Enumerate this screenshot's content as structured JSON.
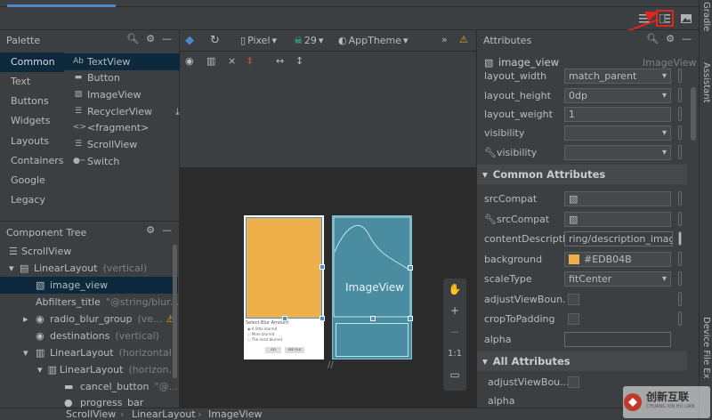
{
  "window": {
    "right_strip": {
      "gradle": "Gradle",
      "assistant": "Assistant",
      "device_explorer": "Device File Ex"
    }
  },
  "palette": {
    "title": "Palette",
    "categories": [
      "Common",
      "Text",
      "Buttons",
      "Widgets",
      "Layouts",
      "Containers",
      "Google",
      "Legacy"
    ],
    "items": [
      {
        "icon": "Ab",
        "label": "TextView"
      },
      {
        "icon": "btn",
        "label": "Button"
      },
      {
        "icon": "img",
        "label": "ImageView"
      },
      {
        "icon": "list",
        "label": "RecyclerView"
      },
      {
        "icon": "<>",
        "label": "<fragment>"
      },
      {
        "icon": "scroll",
        "label": "ScrollView"
      },
      {
        "icon": "switch",
        "label": "Switch"
      }
    ]
  },
  "component_tree": {
    "title": "Component Tree",
    "rows": [
      {
        "label": "ScrollView",
        "extra": ""
      },
      {
        "label": "LinearLayout",
        "extra": "(vertical)"
      },
      {
        "label": "image_view",
        "extra": ""
      },
      {
        "label": "filters_title",
        "extra": "\"@string/blur..."
      },
      {
        "label": "radio_blur_group",
        "extra": "(ve..."
      },
      {
        "label": "destinations",
        "extra": "(vertical)"
      },
      {
        "label": "LinearLayout",
        "extra": "(horizontal)"
      },
      {
        "label": "LinearLayout",
        "extra": "(horizon..."
      },
      {
        "label": "cancel_button",
        "extra": "\"@..."
      },
      {
        "label": "progress_bar",
        "extra": ""
      }
    ]
  },
  "design_toolbar": {
    "device": "Pixel",
    "api": "29",
    "theme": "AppTheme"
  },
  "canvas": {
    "blueprint_label": "ImageView",
    "preview_caption": "Select Blur Amount",
    "options": [
      "A little blurred",
      "More blurred",
      "The most blurred"
    ],
    "buttons": [
      "GO",
      "SEE FILE"
    ],
    "zoom_reset": "1:1"
  },
  "attributes": {
    "title": "Attributes",
    "component_name": "image_view",
    "component_type": "ImageView",
    "layout_rows": [
      {
        "label": "layout_width",
        "value": "match_parent"
      },
      {
        "label": "layout_height",
        "value": "0dp"
      },
      {
        "label": "layout_weight",
        "value": "1"
      },
      {
        "label": "visibility",
        "value": ""
      },
      {
        "label": "visibility",
        "value": ""
      }
    ],
    "common_title": "Common Attributes",
    "common_rows": [
      {
        "label": "srcCompat",
        "value": ""
      },
      {
        "label": "srcCompat",
        "value": ""
      },
      {
        "label": "contentDescripti...",
        "value": "ring/description_image"
      },
      {
        "label": "background",
        "value": "#EDB04B"
      },
      {
        "label": "scaleType",
        "value": "fitCenter"
      },
      {
        "label": "adjustViewBoun...",
        "value": ""
      },
      {
        "label": "cropToPadding",
        "value": ""
      },
      {
        "label": "alpha",
        "value": ""
      }
    ],
    "all_title": "All Attributes",
    "all_rows": [
      {
        "label": "adjustViewBou...",
        "value": ""
      },
      {
        "label": "alpha",
        "value": ""
      }
    ]
  },
  "breadcrumb": [
    "ScrollView",
    "LinearLayout",
    "ImageView"
  ],
  "watermark": {
    "cn": "创新互联",
    "en": "CHUANG XIN HU LIAN"
  },
  "colors": {
    "accent": "#4a88c7",
    "selection": "#0d293e",
    "image_bg": "#EDB04B",
    "annotation_red": "#e0261b"
  }
}
